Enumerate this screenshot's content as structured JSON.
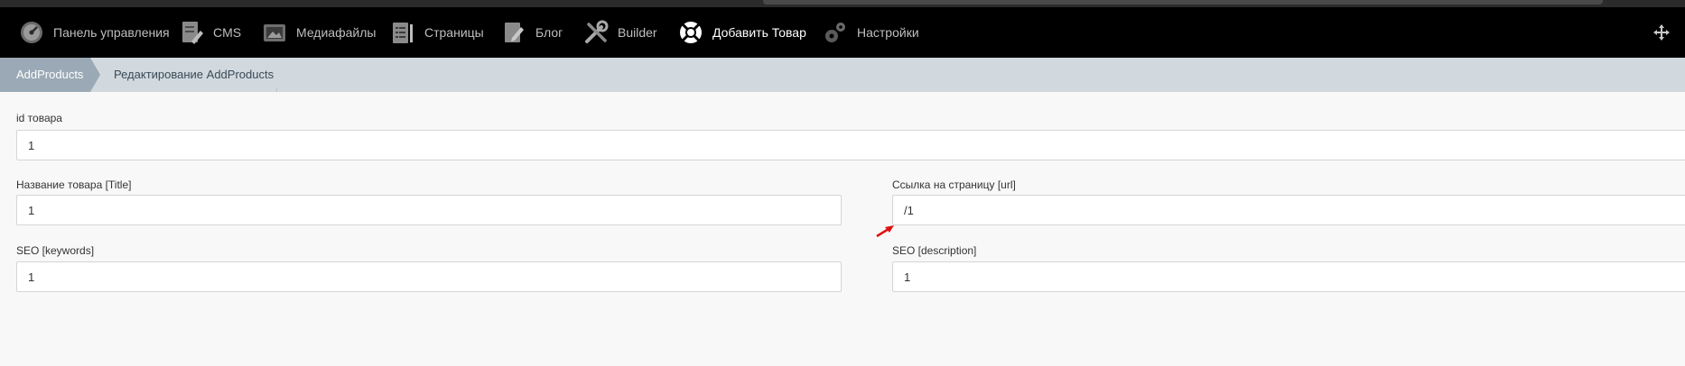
{
  "navbar": {
    "items": [
      {
        "label": "Панель управления",
        "icon": "dashboard-gauge-icon"
      },
      {
        "label": "CMS",
        "icon": "cms-document-icon"
      },
      {
        "label": "Медиафайлы",
        "icon": "media-image-icon"
      },
      {
        "label": "Страницы",
        "icon": "pages-list-icon"
      },
      {
        "label": "Блог",
        "icon": "blog-pencil-icon"
      },
      {
        "label": "Builder",
        "icon": "builder-tools-icon"
      },
      {
        "label": "Добавить Товар",
        "icon": "lifebuoy-icon",
        "active": true
      },
      {
        "label": "Настройки",
        "icon": "settings-gears-icon"
      }
    ],
    "right_icon": "move-arrows-icon"
  },
  "breadcrumb": {
    "active": "AddProducts",
    "current": "Редактирование AddProducts"
  },
  "form": {
    "id": {
      "label": "id товара",
      "value": "1"
    },
    "title": {
      "label": "Название товара [Title]",
      "value": "1"
    },
    "url": {
      "label": "Ссылка на страницу [url]",
      "value": "/1"
    },
    "keywords": {
      "label": "SEO [keywords]",
      "value": "1"
    },
    "description": {
      "label": "SEO [description]",
      "value": "1"
    }
  },
  "colors": {
    "navbar_bg": "#000000",
    "crumb_bg": "#d1d9df",
    "crumb_active_bg": "#9aa9b5",
    "annotation_arrow": "#e01010"
  }
}
